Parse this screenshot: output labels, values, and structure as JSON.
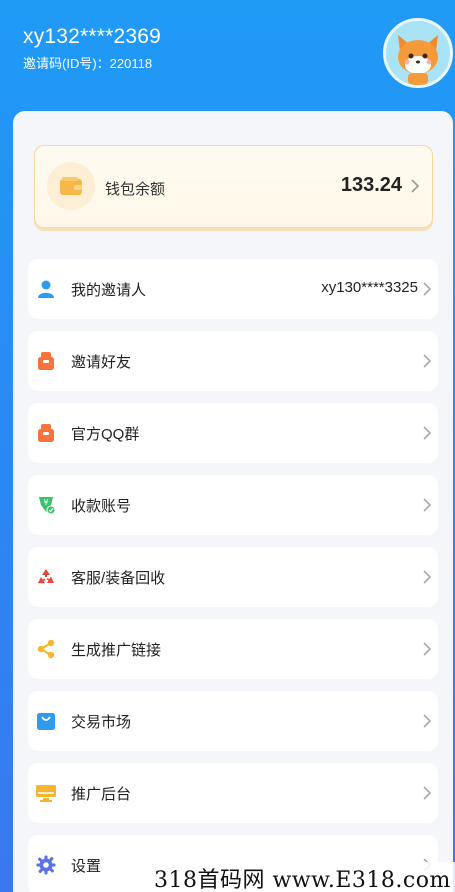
{
  "user": {
    "name": "xy132****2369",
    "invite_code": "邀请码(ID号)：220118"
  },
  "wallet": {
    "label": "钱包余额",
    "amount": "133.24"
  },
  "menu": [
    {
      "label": "我的邀请人",
      "value": "xy130****3325",
      "icon": "user-icon",
      "color": "#2d9bf0"
    },
    {
      "label": "邀请好友",
      "value": "",
      "icon": "gift-icon",
      "color": "#f7733b"
    },
    {
      "label": "官方QQ群",
      "value": "",
      "icon": "gift-icon",
      "color": "#f7733b"
    },
    {
      "label": "收款账号",
      "value": "",
      "icon": "money-check-icon",
      "color": "#3bc06b"
    },
    {
      "label": "客服/装备回收",
      "value": "",
      "icon": "recycle-icon",
      "color": "#e8453c"
    },
    {
      "label": "生成推广链接",
      "value": "",
      "icon": "share-icon",
      "color": "#f5b52e"
    },
    {
      "label": "交易市场",
      "value": "",
      "icon": "shopping-bag-icon",
      "color": "#2d9bf0"
    },
    {
      "label": "推广后台",
      "value": "",
      "icon": "monitor-icon",
      "color": "#f5b52e"
    },
    {
      "label": "设置",
      "value": "",
      "icon": "gear-icon",
      "color": "#5b6fe6"
    }
  ],
  "watermark": "318首码网 www.E318.com"
}
